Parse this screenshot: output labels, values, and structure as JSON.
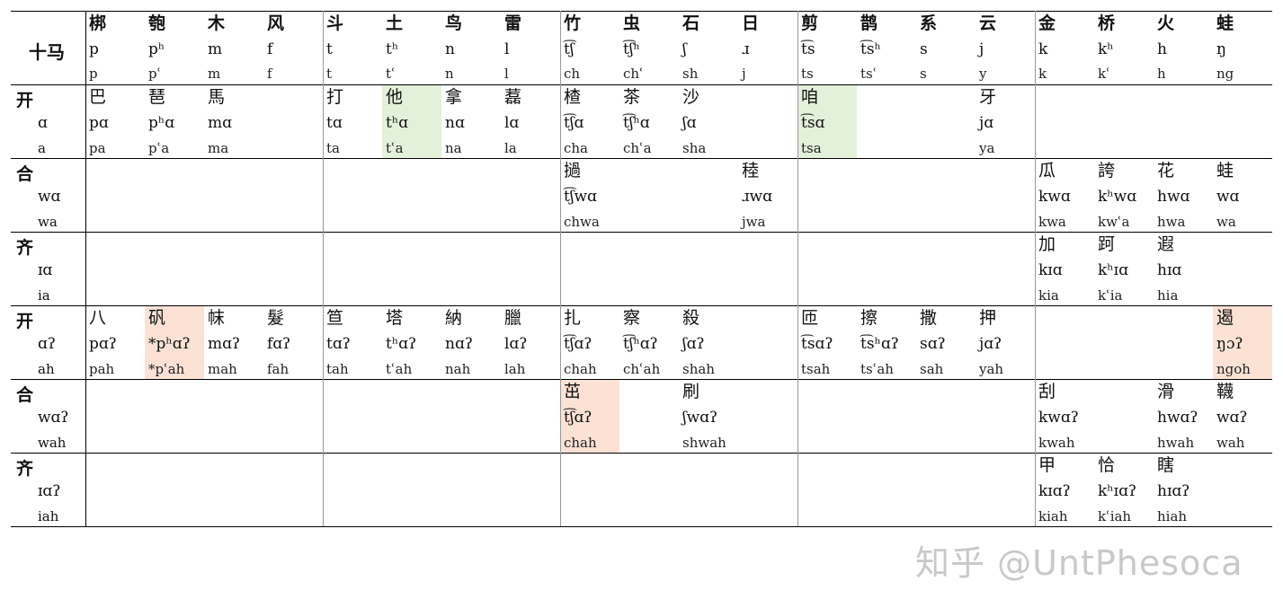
{
  "corner_label": "十马",
  "highlight_colors": {
    "green": "#e3f0da",
    "orange": "#fbe2d5"
  },
  "initials": [
    {
      "char": "梆",
      "ipa": "p",
      "rom": "p"
    },
    {
      "char": "匏",
      "ipa": "pʰ",
      "rom": "pʿ"
    },
    {
      "char": "木",
      "ipa": "m",
      "rom": "m"
    },
    {
      "char": "风",
      "ipa": "f",
      "rom": "f"
    },
    {
      "char": "斗",
      "ipa": "t",
      "rom": "t"
    },
    {
      "char": "土",
      "ipa": "tʰ",
      "rom": "tʿ"
    },
    {
      "char": "鸟",
      "ipa": "n",
      "rom": "n"
    },
    {
      "char": "雷",
      "ipa": "l",
      "rom": "l"
    },
    {
      "char": "竹",
      "ipa": "t͡ʃ",
      "rom": "ch"
    },
    {
      "char": "虫",
      "ipa": "t͡ʃʰ",
      "rom": "chʿ"
    },
    {
      "char": "石",
      "ipa": "ʃ",
      "rom": "sh"
    },
    {
      "char": "日",
      "ipa": "ɹ",
      "rom": "j"
    },
    {
      "char": "剪",
      "ipa": "t͡s",
      "rom": "ts"
    },
    {
      "char": "鹊",
      "ipa": "t͡sʰ",
      "rom": "tsʿ"
    },
    {
      "char": "系",
      "ipa": "s",
      "rom": "s"
    },
    {
      "char": "云",
      "ipa": "j",
      "rom": "y"
    },
    {
      "char": "金",
      "ipa": "k",
      "rom": "k"
    },
    {
      "char": "桥",
      "ipa": "kʰ",
      "rom": "kʿ"
    },
    {
      "char": "火",
      "ipa": "h",
      "rom": "h"
    },
    {
      "char": "蛙",
      "ipa": "ŋ",
      "rom": "ng"
    }
  ],
  "rows": [
    {
      "name": "开",
      "ipa": "ɑ",
      "rom": "a",
      "cells": [
        {
          "col": 0,
          "char": "巴",
          "ipa": "pɑ",
          "rom": "pa"
        },
        {
          "col": 1,
          "char": "琶",
          "ipa": "pʰɑ",
          "rom": "pʿa"
        },
        {
          "col": 2,
          "char": "馬",
          "ipa": "mɑ",
          "rom": "ma"
        },
        {
          "col": 4,
          "char": "打",
          "ipa": "tɑ",
          "rom": "ta"
        },
        {
          "col": 5,
          "char": "他",
          "ipa": "tʰɑ",
          "rom": "tʿa",
          "hl": "green"
        },
        {
          "col": 6,
          "char": "拿",
          "ipa": "nɑ",
          "rom": "na"
        },
        {
          "col": 7,
          "char": "藞",
          "ipa": "lɑ",
          "rom": "la"
        },
        {
          "col": 8,
          "char": "楂",
          "ipa": "t͡ʃɑ",
          "rom": "cha"
        },
        {
          "col": 9,
          "char": "茶",
          "ipa": "t͡ʃʰɑ",
          "rom": "chʿa"
        },
        {
          "col": 10,
          "char": "沙",
          "ipa": "ʃɑ",
          "rom": "sha"
        },
        {
          "col": 12,
          "char": "咱",
          "ipa": "t͡sɑ",
          "rom": "tsa",
          "hl": "green"
        },
        {
          "col": 15,
          "char": "牙",
          "ipa": "jɑ",
          "rom": "ya"
        }
      ]
    },
    {
      "name": "合",
      "ipa": "wɑ",
      "rom": "wa",
      "cells": [
        {
          "col": 8,
          "char": "撾",
          "ipa": "t͡ʃwɑ",
          "rom": "chwa"
        },
        {
          "col": 11,
          "char": "稑",
          "ipa": "ɹwɑ",
          "rom": "jwa"
        },
        {
          "col": 16,
          "char": "瓜",
          "ipa": "kwɑ",
          "rom": "kwa"
        },
        {
          "col": 17,
          "char": "誇",
          "ipa": "kʰwɑ",
          "rom": "kwʿa"
        },
        {
          "col": 18,
          "char": "花",
          "ipa": "hwɑ",
          "rom": "hwa"
        },
        {
          "col": 19,
          "char": "蛙",
          "ipa": "wɑ",
          "rom": "wa"
        }
      ]
    },
    {
      "name": "齐",
      "ipa": "ɪɑ",
      "rom": "ia",
      "cells": [
        {
          "col": 16,
          "char": "加",
          "ipa": "kɪɑ",
          "rom": "kia"
        },
        {
          "col": 17,
          "char": "跒",
          "ipa": "kʰɪɑ",
          "rom": "kʿia"
        },
        {
          "col": 18,
          "char": "遐",
          "ipa": "hɪɑ",
          "rom": "hia"
        }
      ]
    },
    {
      "name": "开",
      "ipa": "ɑʔ",
      "rom": "ah",
      "cells": [
        {
          "col": 0,
          "char": "八",
          "ipa": "pɑʔ",
          "rom": "pah"
        },
        {
          "col": 1,
          "char": "矾",
          "ipa": "*pʰɑʔ",
          "rom": "*pʿah",
          "hl": "orange"
        },
        {
          "col": 2,
          "char": "帓",
          "ipa": "mɑʔ",
          "rom": "mah"
        },
        {
          "col": 3,
          "char": "髮",
          "ipa": "fɑʔ",
          "rom": "fah"
        },
        {
          "col": 4,
          "char": "笪",
          "ipa": "tɑʔ",
          "rom": "tah"
        },
        {
          "col": 5,
          "char": "塔",
          "ipa": "tʰɑʔ",
          "rom": "tʿah"
        },
        {
          "col": 6,
          "char": "納",
          "ipa": "nɑʔ",
          "rom": "nah"
        },
        {
          "col": 7,
          "char": "臘",
          "ipa": "lɑʔ",
          "rom": "lah"
        },
        {
          "col": 8,
          "char": "扎",
          "ipa": "t͡ʃɑʔ",
          "rom": "chah"
        },
        {
          "col": 9,
          "char": "察",
          "ipa": "t͡ʃʰɑʔ",
          "rom": "chʿah"
        },
        {
          "col": 10,
          "char": "殺",
          "ipa": "ʃɑʔ",
          "rom": "shah"
        },
        {
          "col": 12,
          "char": "匝",
          "ipa": "t͡sɑʔ",
          "rom": "tsah"
        },
        {
          "col": 13,
          "char": "擦",
          "ipa": "t͡sʰɑʔ",
          "rom": "tsʿah"
        },
        {
          "col": 14,
          "char": "撒",
          "ipa": "sɑʔ",
          "rom": "sah"
        },
        {
          "col": 15,
          "char": "押",
          "ipa": "jɑʔ",
          "rom": "yah"
        },
        {
          "col": 19,
          "char": "遏",
          "ipa": "ŋɔʔ",
          "rom": "ngoh",
          "hl": "orange"
        }
      ]
    },
    {
      "name": "合",
      "ipa": "wɑʔ",
      "rom": "wah",
      "cells": [
        {
          "col": 8,
          "char": "茁",
          "ipa": "t͡ʃɑʔ",
          "rom": "chah",
          "hl": "orange"
        },
        {
          "col": 10,
          "char": "刷",
          "ipa": "ʃwɑʔ",
          "rom": "shwah"
        },
        {
          "col": 16,
          "char": "刮",
          "ipa": "kwɑʔ",
          "rom": "kwah"
        },
        {
          "col": 18,
          "char": "滑",
          "ipa": "hwɑʔ",
          "rom": "hwah"
        },
        {
          "col": 19,
          "char": "韈",
          "ipa": "wɑʔ",
          "rom": "wah"
        }
      ]
    },
    {
      "name": "齐",
      "ipa": "ɪɑʔ",
      "rom": "iah",
      "cells": [
        {
          "col": 16,
          "char": "甲",
          "ipa": "kɪɑʔ",
          "rom": "kiah"
        },
        {
          "col": 17,
          "char": "恰",
          "ipa": "kʰɪɑʔ",
          "rom": "kʿiah"
        },
        {
          "col": 18,
          "char": "瞎",
          "ipa": "hɪɑʔ",
          "rom": "hiah"
        }
      ]
    }
  ],
  "watermark": "知乎 @UntPhesoca"
}
